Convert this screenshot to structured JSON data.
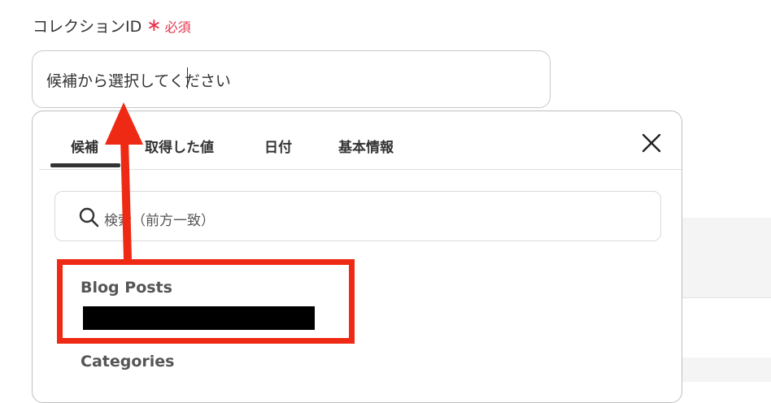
{
  "field": {
    "label": "コレクションID",
    "required_star": "∗",
    "required_text": "必須"
  },
  "select": {
    "value": "候補から選択してください"
  },
  "dropdown": {
    "tabs": [
      "候補",
      "取得した値",
      "日付",
      "基本情報"
    ],
    "active_tab": "候補",
    "close_icon": "close-icon",
    "search": {
      "icon": "search-icon",
      "placeholder": "検索（前方一致）"
    },
    "options": [
      {
        "label": "Blog Posts",
        "sub_value_redacted": true
      },
      {
        "label": "Categories"
      }
    ]
  },
  "annotation": {
    "highlight_color": "#ee2a14",
    "arrow_color": "#ee2a14"
  },
  "colors": {
    "required": "#e5334b",
    "text": "#333333"
  }
}
